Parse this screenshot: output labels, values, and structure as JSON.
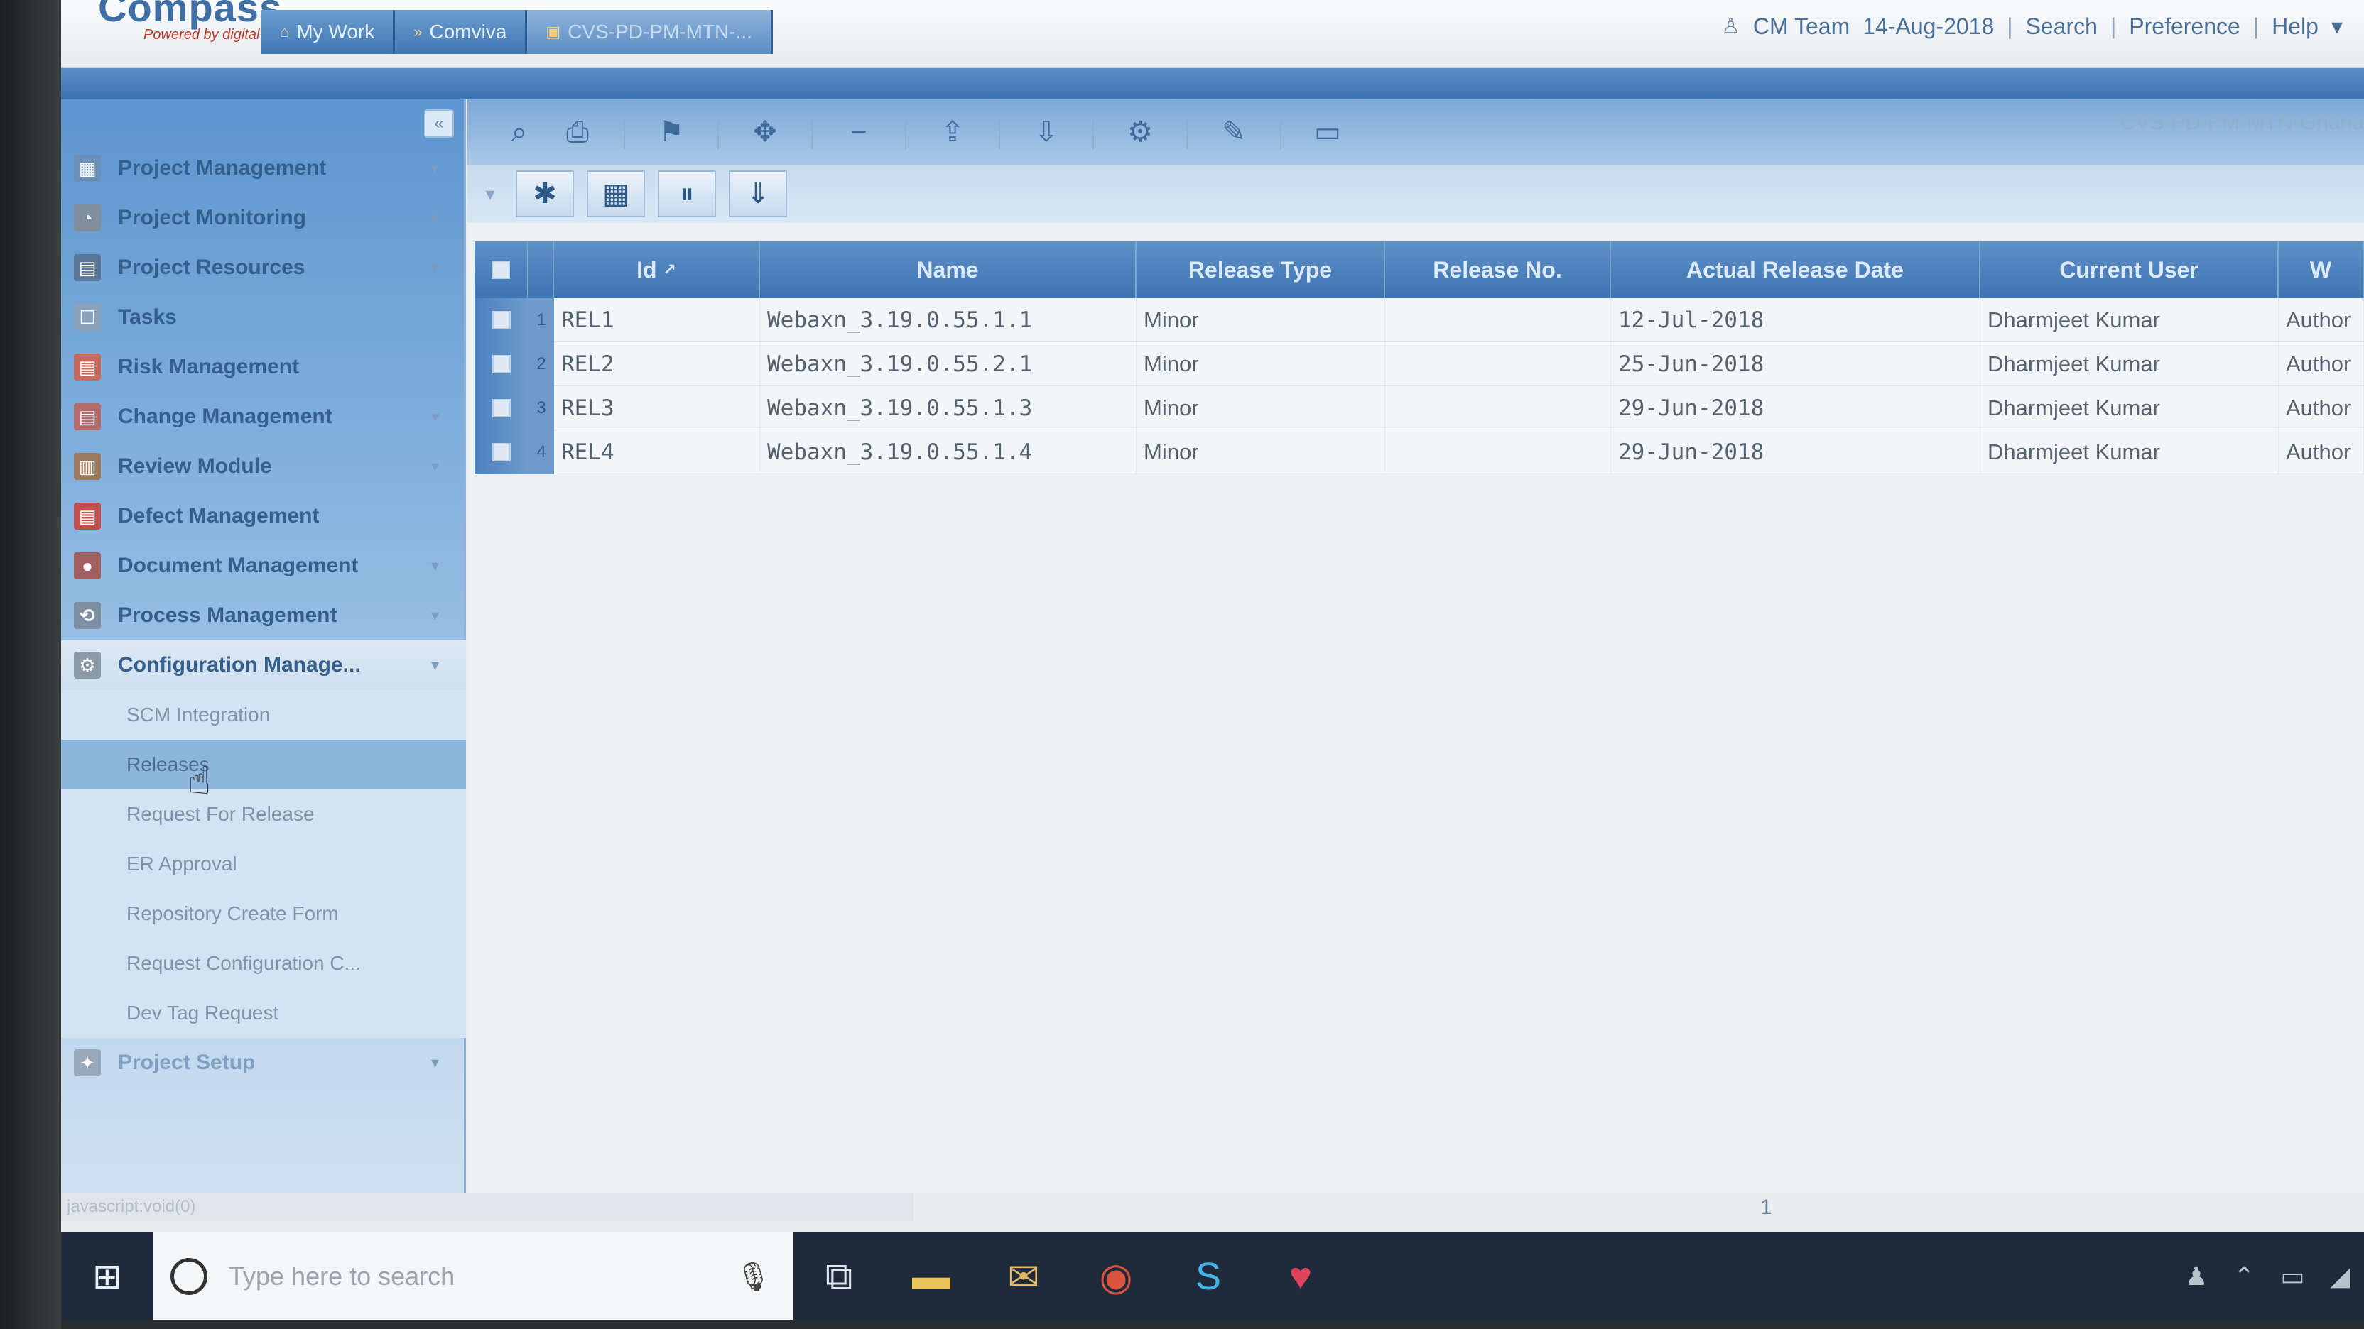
{
  "header": {
    "logo_text": "Compass",
    "logo_sub": "Powered by digital",
    "breadcrumb": [
      {
        "label": "My Work",
        "icon": "home-icon"
      },
      {
        "label": "Comviva",
        "icon": "org-icon"
      },
      {
        "label": "CVS-PD-PM-MTN-...",
        "icon": "project-icon"
      }
    ],
    "user": "CM Team",
    "date": "14-Aug-2018",
    "links": [
      "Search",
      "Preference",
      "Help"
    ]
  },
  "sidebar": {
    "items": [
      {
        "label": "Project Management",
        "icon": "project-management-icon",
        "has_submenu": true
      },
      {
        "label": "Project Monitoring",
        "icon": "monitoring-icon",
        "has_submenu": true
      },
      {
        "label": "Project Resources",
        "icon": "resources-icon",
        "has_submenu": true
      },
      {
        "label": "Tasks",
        "icon": "tasks-icon",
        "has_submenu": false
      },
      {
        "label": "Risk Management",
        "icon": "risk-icon",
        "has_submenu": false
      },
      {
        "label": "Change Management",
        "icon": "change-icon",
        "has_submenu": true
      },
      {
        "label": "Review Module",
        "icon": "review-icon",
        "has_submenu": true
      },
      {
        "label": "Defect Management",
        "icon": "defect-icon",
        "has_submenu": false
      },
      {
        "label": "Document Management",
        "icon": "document-icon",
        "has_submenu": true
      },
      {
        "label": "Process Management",
        "icon": "process-icon",
        "has_submenu": true
      },
      {
        "label": "Configuration Manage...",
        "icon": "configuration-icon",
        "has_submenu": true
      }
    ],
    "submenu": [
      "SCM Integration",
      "Releases",
      "Request For Release",
      "ER Approval",
      "Repository Create Form",
      "Request Configuration C...",
      "Dev Tag Request"
    ],
    "active_sub": "Releases",
    "last_item": {
      "label": "Project Setup",
      "icon": "setup-icon"
    }
  },
  "main": {
    "project_title": "CVS-PD-PM-MTN-Ghana",
    "toolbar1_icons": [
      "search-icon",
      "print-icon",
      "filter-icon",
      "move-icon",
      "minus-icon",
      "export-icon",
      "import-icon",
      "settings-icon",
      "edit-icon",
      "save-icon"
    ],
    "toolbar2_icons": [
      "add-icon",
      "columns-icon",
      "freeze-icon",
      "download-icon"
    ]
  },
  "grid": {
    "columns": [
      "Id",
      "Name",
      "Release Type",
      "Release No.",
      "Actual Release Date",
      "Current User",
      "W"
    ],
    "rows": [
      {
        "num": "1",
        "id": "REL1",
        "name": "Webaxn_3.19.0.55.1.1",
        "type": "Minor",
        "release_no": "",
        "date": "12-Jul-2018",
        "user": "Dharmjeet Kumar",
        "extra": "Author"
      },
      {
        "num": "2",
        "id": "REL2",
        "name": "Webaxn_3.19.0.55.2.1",
        "type": "Minor",
        "release_no": "",
        "date": "25-Jun-2018",
        "user": "Dharmjeet Kumar",
        "extra": "Author"
      },
      {
        "num": "3",
        "id": "REL3",
        "name": "Webaxn_3.19.0.55.1.3",
        "type": "Minor",
        "release_no": "",
        "date": "29-Jun-2018",
        "user": "Dharmjeet Kumar",
        "extra": "Author"
      },
      {
        "num": "4",
        "id": "REL4",
        "name": "Webaxn_3.19.0.55.1.4",
        "type": "Minor",
        "release_no": "",
        "date": "29-Jun-2018",
        "user": "Dharmjeet Kumar",
        "extra": "Author"
      }
    ]
  },
  "pager": {
    "page": "1"
  },
  "status": {
    "text": "javascript:void(0)"
  },
  "taskbar": {
    "search_placeholder": "Type here to search",
    "apps": [
      "task-view-icon",
      "file-explorer-icon",
      "outlook-icon",
      "chrome-icon",
      "skype-icon",
      "app-icon"
    ]
  }
}
